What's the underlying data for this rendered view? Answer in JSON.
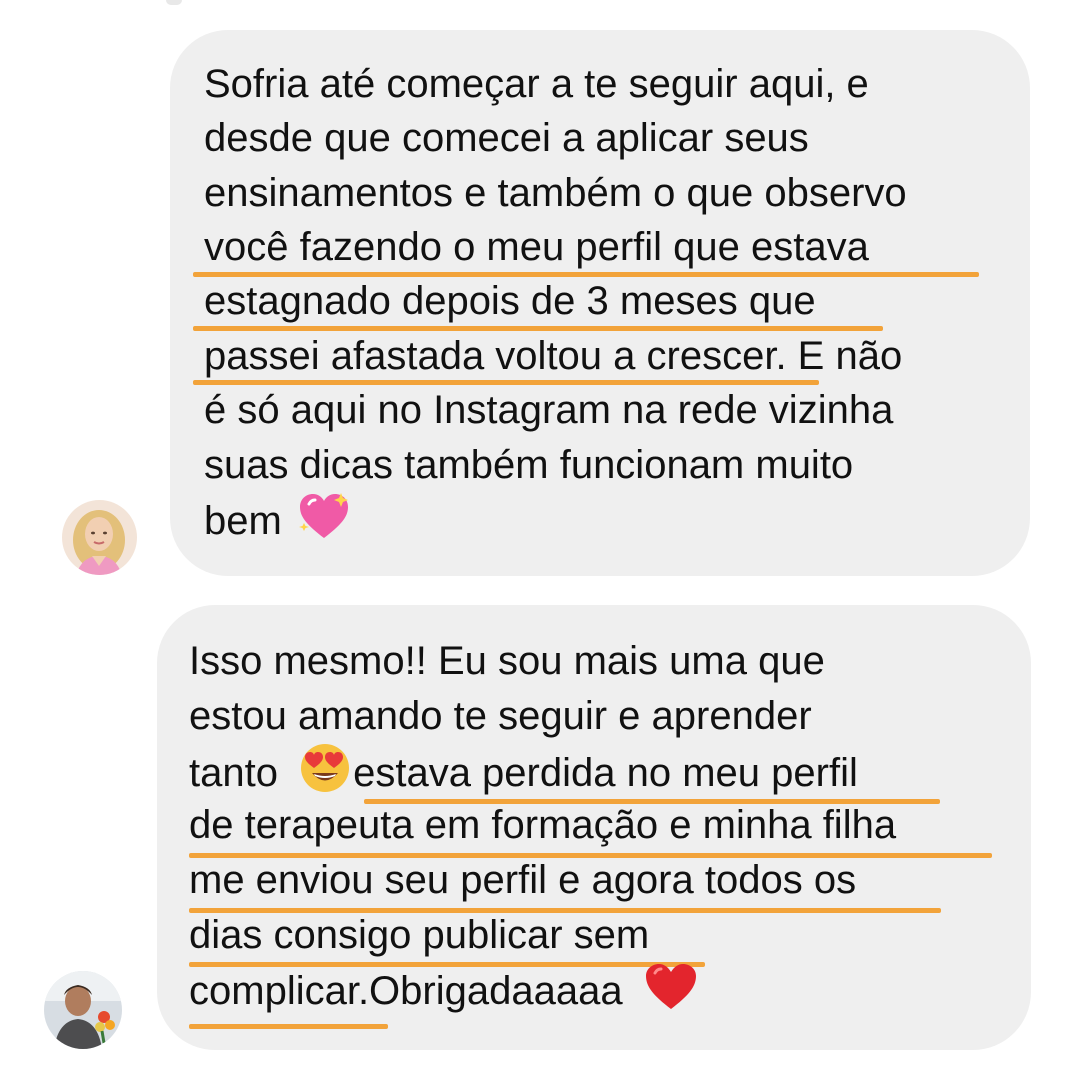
{
  "messages": [
    {
      "id": "message-1",
      "lines": [
        "Sofria até começar a te seguir aqui, e",
        "desde que comecei a aplicar seus",
        "ensinamentos e também o que observo",
        "você fazendo o meu perfil que estava",
        "estagnado depois de 3 meses que",
        "passei afastada voltou a crescer. E não",
        "é só aqui no Instagram na rede vizinha",
        "suas dicas também funcionam muito",
        "bem"
      ],
      "trailing_emoji": "sparkling-heart"
    },
    {
      "id": "message-2",
      "lines": [
        "Isso mesmo!! Eu sou mais uma que",
        "estou amando te seguir e aprender",
        "tanto",
        "estava perdida no meu perfil",
        "de terapeuta em formação e minha filha",
        "me enviou seu perfil e agora todos os",
        "dias consigo publicar sem",
        "complicar.Obrigadaaaaa"
      ],
      "inline_emoji": "heart-eyes-face",
      "trailing_emoji": "red-heart"
    }
  ],
  "colors": {
    "bubble": "#efefef",
    "highlight": "#f2a33a",
    "text": "#111111"
  }
}
